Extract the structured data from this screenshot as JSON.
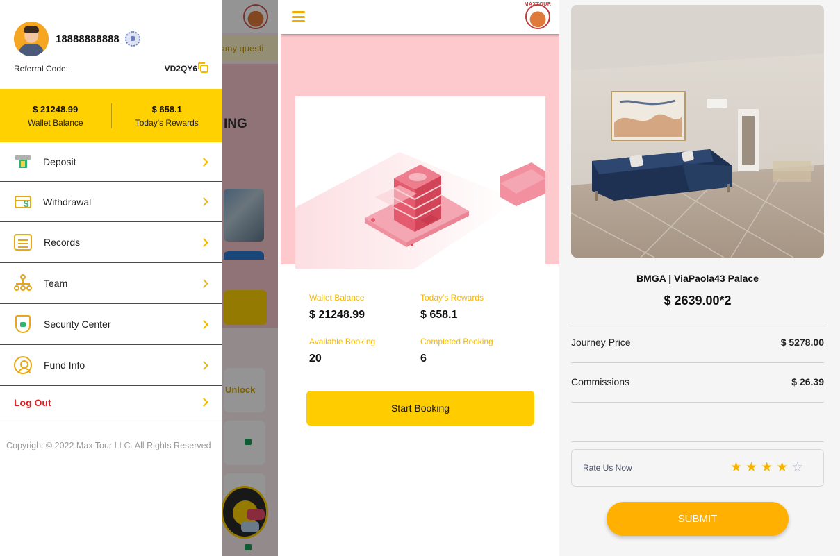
{
  "underlay": {
    "marquee_text": "any questi",
    "heading_fragment": "ING",
    "unlock_label": "Unlock"
  },
  "drawer": {
    "phone": "18888888888",
    "referral_label": "Referral Code:",
    "referral_code": "VD2QY6",
    "wallet_balance_value": "$ 21248.99",
    "wallet_balance_label": "Wallet Balance",
    "todays_rewards_value": "$ 658.1",
    "todays_rewards_label": "Today's Rewards",
    "menu": [
      {
        "label": "Deposit",
        "icon": "deposit-icon"
      },
      {
        "label": "Withdrawal",
        "icon": "withdrawal-card-icon"
      },
      {
        "label": "Records",
        "icon": "calendar-records-icon"
      },
      {
        "label": "Team",
        "icon": "team-tree-icon"
      },
      {
        "label": "Security Center",
        "icon": "shield-lock-icon"
      },
      {
        "label": "Fund Info",
        "icon": "user-circle-icon"
      }
    ],
    "logout_label": "Log Out",
    "copyright": "Copyright © 2022 Max Tour LLC. All Rights Reserved"
  },
  "middle": {
    "logo_text": "MAXTOUR",
    "stats": {
      "wallet_balance_label": "Wallet Balance",
      "wallet_balance_value": "$ 21248.99",
      "todays_rewards_label": "Today's Rewards",
      "todays_rewards_value": "$ 658.1",
      "available_booking_label": "Available Booking",
      "available_booking_value": "20",
      "completed_booking_label": "Completed Booking",
      "completed_booking_value": "6"
    },
    "start_button": "Start Booking"
  },
  "right": {
    "product_title": "BMGA | ViaPaola43 Palace",
    "product_price": "$ 2639.00*2",
    "journey_price_label": "Journey Price",
    "journey_price_value": "$ 5278.00",
    "commissions_label": "Commissions",
    "commissions_value": "$ 26.39",
    "rate_label": "Rate Us Now",
    "rating": 4,
    "rating_max": 5,
    "submit_label": "SUBMIT"
  },
  "colors": {
    "accent_yellow": "#ffd100",
    "accent_orange": "#ffb000",
    "hero_pink": "#fdc9cc",
    "logout_red": "#e01f1f"
  }
}
